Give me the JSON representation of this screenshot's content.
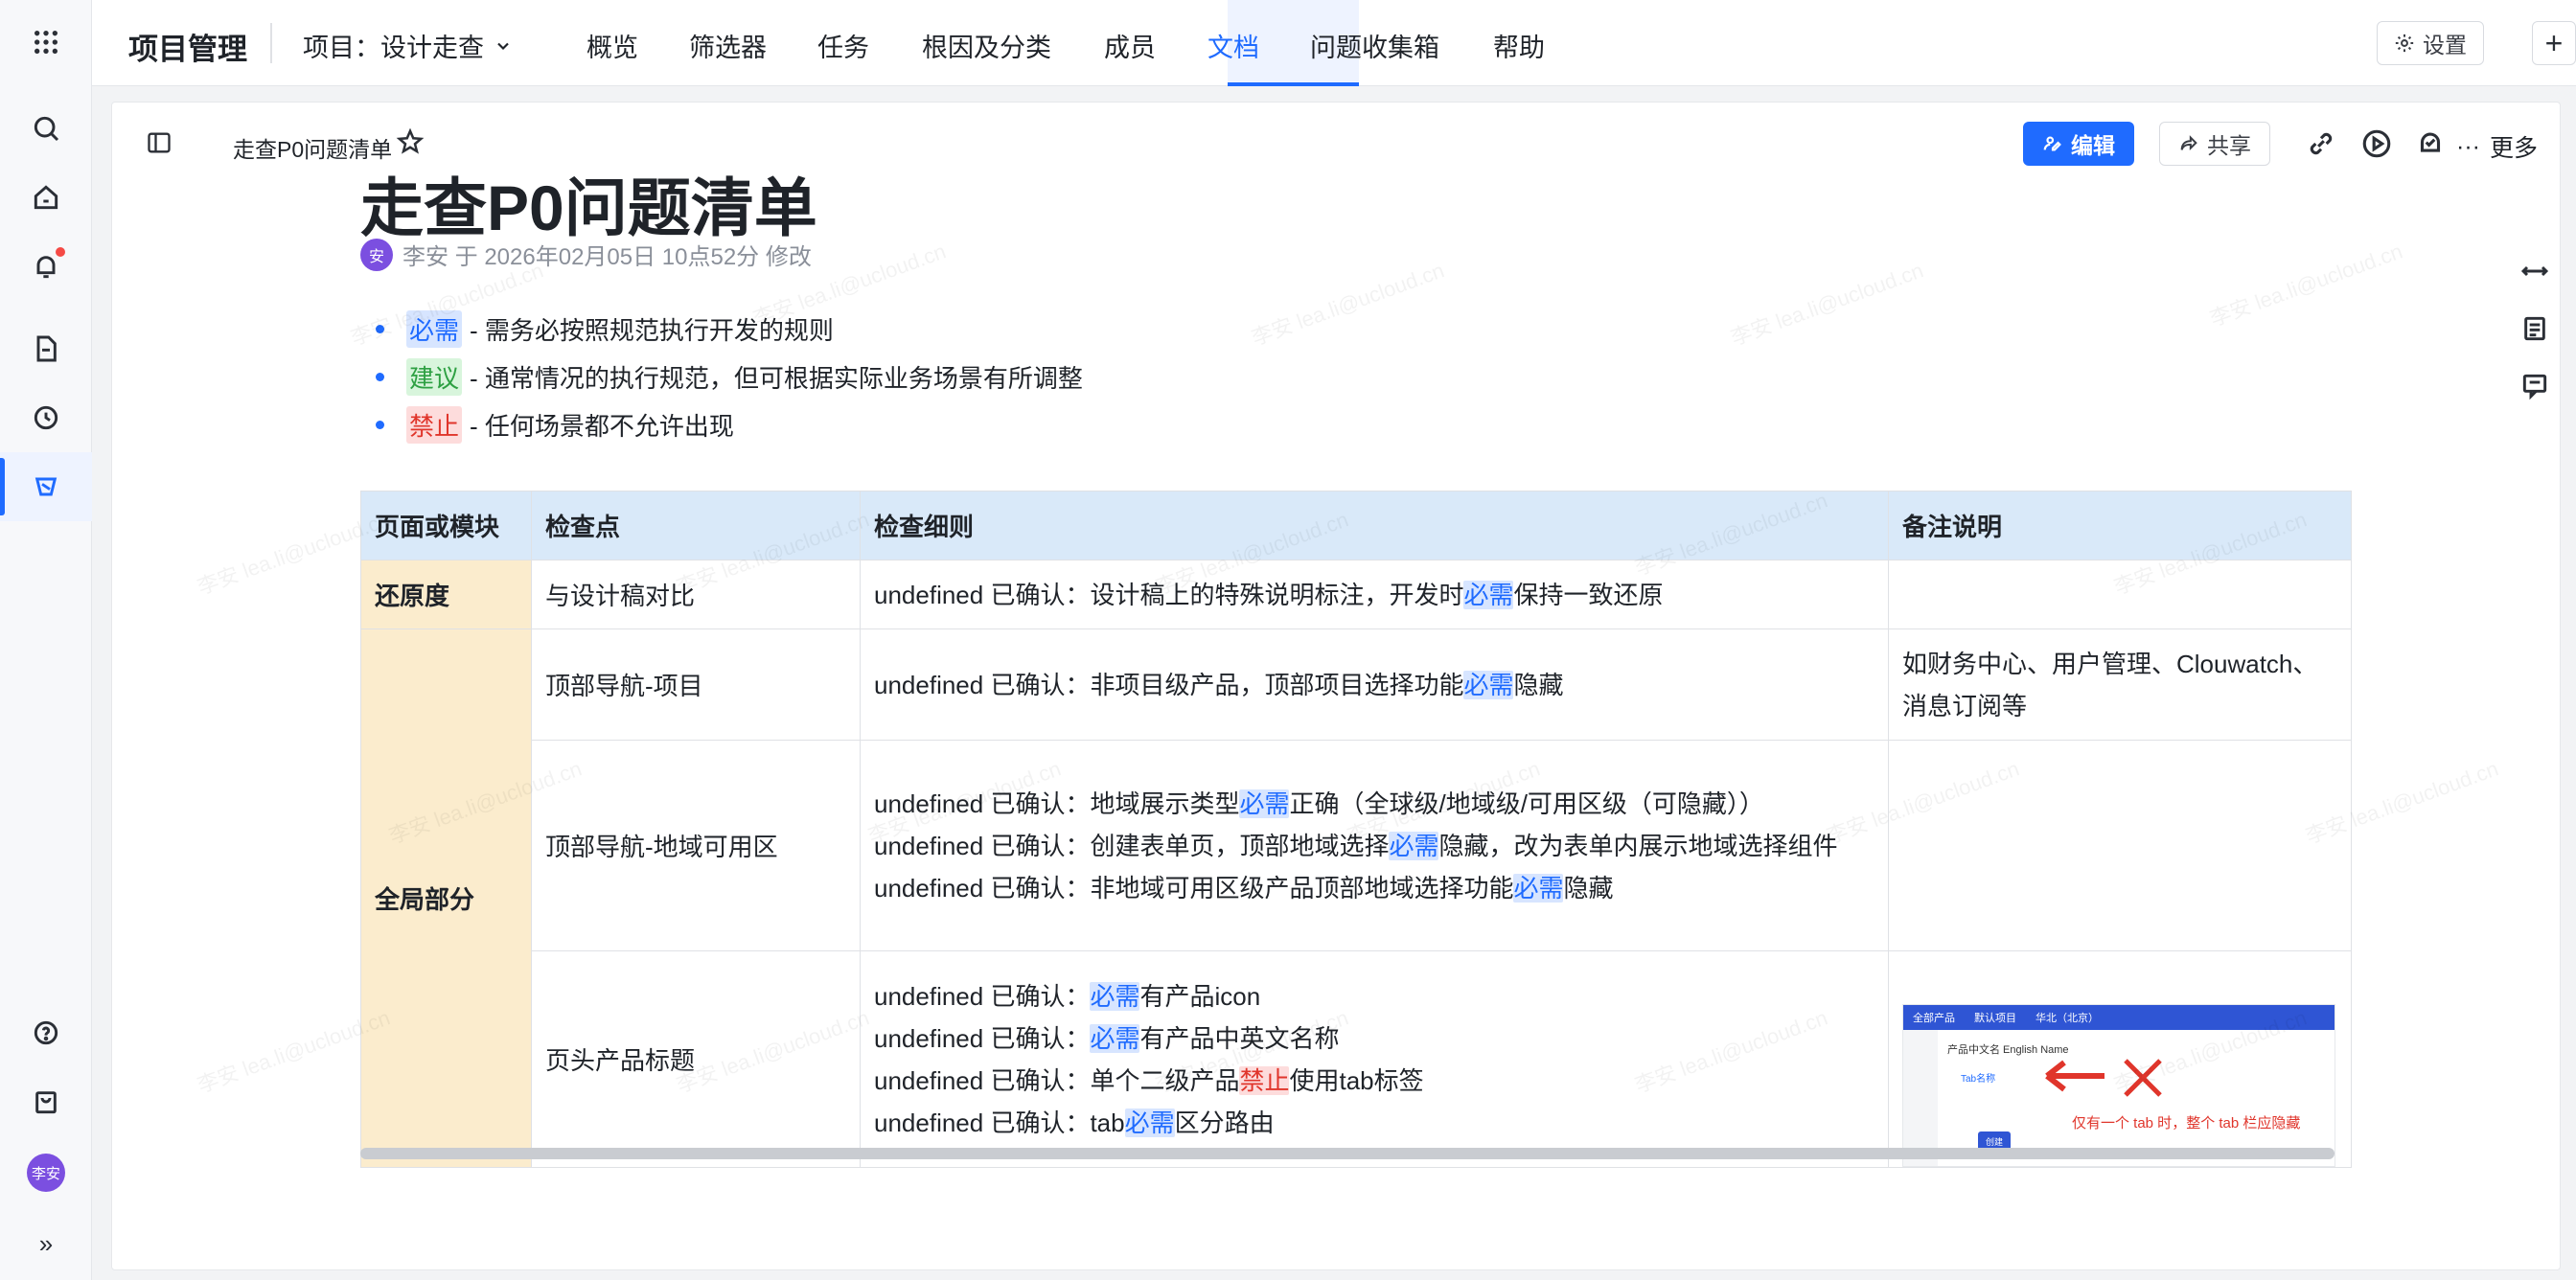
{
  "topnav": {
    "app_title": "项目管理",
    "project_selector": "项目：设计走查",
    "tabs": [
      {
        "label": "概览"
      },
      {
        "label": "筛选器"
      },
      {
        "label": "任务"
      },
      {
        "label": "根因及分类"
      },
      {
        "label": "成员"
      },
      {
        "label": "文档",
        "active": true
      },
      {
        "label": "问题收集箱"
      },
      {
        "label": "帮助"
      }
    ],
    "settings_label": "设置",
    "accent_color": "#1f6bff"
  },
  "rail": {
    "items": [
      "grid-icon",
      "search-icon",
      "home-icon",
      "bell-icon",
      "document-icon",
      "clock-icon",
      "project-icon"
    ],
    "bottom": [
      "help-icon",
      "box-icon"
    ],
    "avatar_text": "李安"
  },
  "toolbar": {
    "doc_name": "走查P0问题清单",
    "edit_label": "编辑",
    "share_label": "共享",
    "more_label": "更多"
  },
  "doc": {
    "title": "走查P0问题清单",
    "meta_avatar": "安",
    "meta_text": "李安 于 2026年02月05日 10点52分 修改",
    "legend": [
      {
        "tag": "必需",
        "text": "- 需务必按照规范执行开发的规则",
        "color": "blue"
      },
      {
        "tag": "建议",
        "text": "- 通常情况的执行规范，但可根据实际业务场景有所调整",
        "color": "green"
      },
      {
        "tag": "禁止",
        "text": "- 任何场景都不允许出现",
        "color": "red"
      }
    ]
  },
  "table": {
    "headers": [
      "页面或模块",
      "检查点",
      "检查细则",
      "备注说明"
    ],
    "rows": [
      {
        "category": "还原度",
        "check": "与设计稿对比",
        "details": [
          [
            {
              "t": "undefined 已确认：设计稿上的特殊说明标注，开发时"
            },
            {
              "t": "必需",
              "hl": "blue"
            },
            {
              "t": "保持一致还原"
            }
          ]
        ],
        "note": ""
      },
      {
        "category": "全局部分",
        "check": "顶部导航-项目",
        "details": [
          [
            {
              "t": "undefined 已确认：非项目级产品，顶部项目选择功能"
            },
            {
              "t": "必需",
              "hl": "blue"
            },
            {
              "t": "隐藏"
            }
          ]
        ],
        "note": "如财务中心、用户管理、Clouwatch、消息订阅等"
      },
      {
        "check": "顶部导航-地域可用区",
        "details": [
          [
            {
              "t": "undefined 已确认：地域展示类型"
            },
            {
              "t": "必需",
              "hl": "blue"
            },
            {
              "t": "正确（全球级/地域级/可用区级（可隐藏））"
            }
          ],
          [
            {
              "t": "undefined 已确认：创建表单页，顶部地域选择"
            },
            {
              "t": "必需",
              "hl": "blue"
            },
            {
              "t": "隐藏，改为表单内展示地域选择组件"
            }
          ],
          [
            {
              "t": "undefined 已确认：非地域可用区级产品顶部地域选择功能"
            },
            {
              "t": "必需",
              "hl": "blue"
            },
            {
              "t": "隐藏"
            }
          ]
        ],
        "note": ""
      },
      {
        "check": "页头产品标题",
        "details": [
          [
            {
              "t": "undefined 已确认："
            },
            {
              "t": "必需",
              "hl": "blue"
            },
            {
              "t": "有产品icon"
            }
          ],
          [
            {
              "t": "undefined 已确认："
            },
            {
              "t": "必需",
              "hl": "blue"
            },
            {
              "t": "有产品中英文名称"
            }
          ],
          [
            {
              "t": "undefined 已确认：单个二级产品"
            },
            {
              "t": "禁止",
              "hl": "red"
            },
            {
              "t": "使用tab标签"
            }
          ],
          [
            {
              "t": "undefined 已确认：tab"
            },
            {
              "t": "必需",
              "hl": "blue"
            },
            {
              "t": "区分路由"
            }
          ]
        ],
        "note_image": {
          "top_items": [
            "全部产品",
            "默认项目",
            "华北（北京）"
          ],
          "product_line": "产品中文名 English Name",
          "tab_label": "Tab名称",
          "button_label": "创建",
          "note": "仅有一个 tab 时，整个 tab 栏应隐藏"
        }
      }
    ]
  },
  "watermark": "李安 lea.li@ucloud.cn"
}
